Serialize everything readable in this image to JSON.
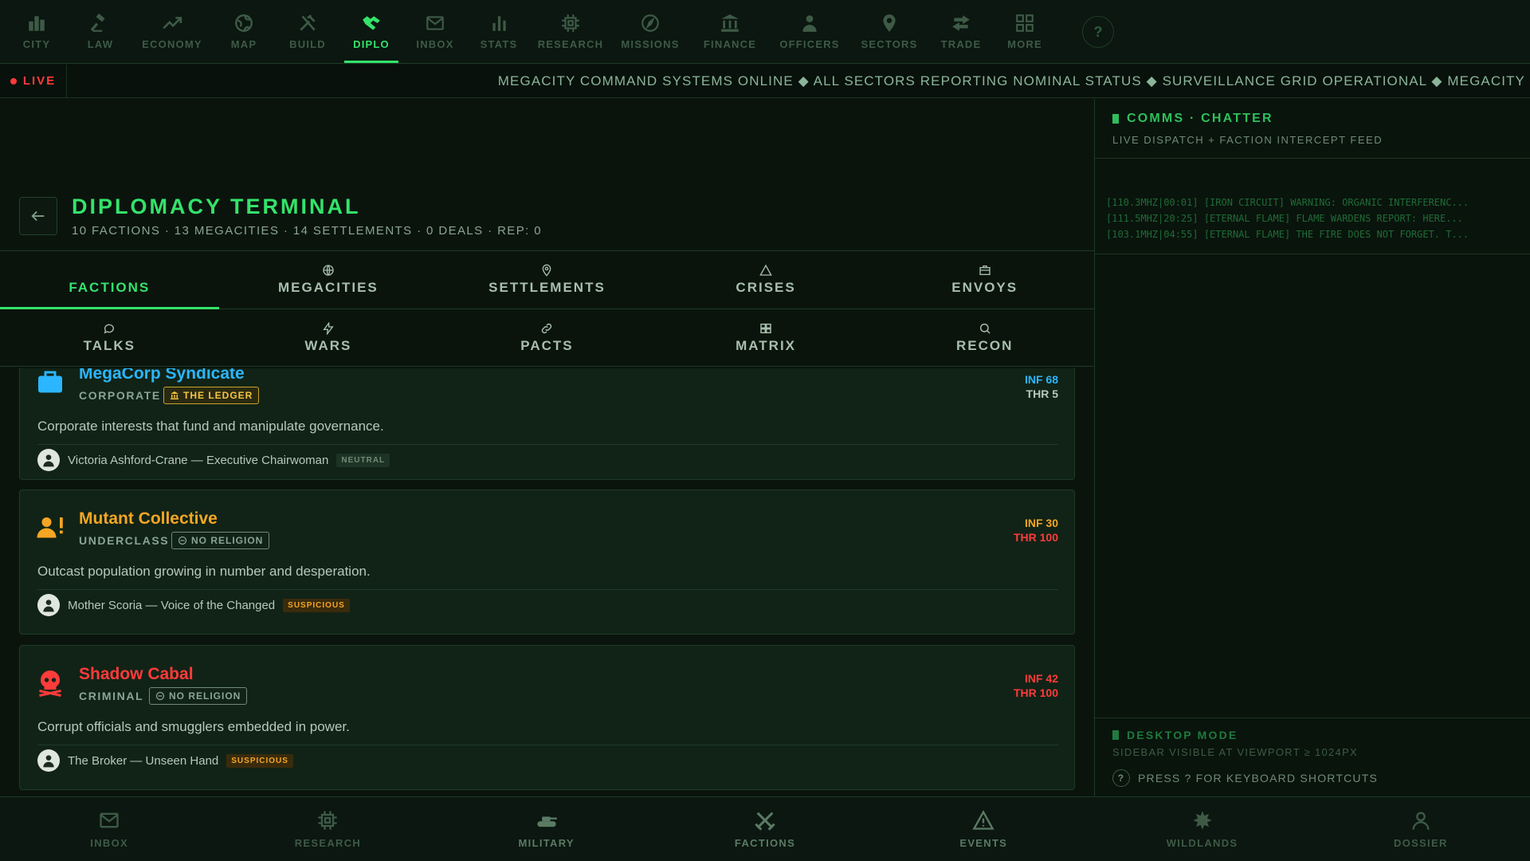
{
  "top_nav": {
    "items": [
      {
        "label": "CITY",
        "icon": "city-icon"
      },
      {
        "label": "LAW",
        "icon": "gavel-icon"
      },
      {
        "label": "ECONOMY",
        "icon": "trend-icon"
      },
      {
        "label": "MAP",
        "icon": "globe-icon"
      },
      {
        "label": "BUILD",
        "icon": "tools-icon"
      },
      {
        "label": "DIPLO",
        "icon": "handshake-icon",
        "active": true
      },
      {
        "label": "INBOX",
        "icon": "mail-icon"
      },
      {
        "label": "STATS",
        "icon": "bar-chart-icon"
      },
      {
        "label": "RESEARCH",
        "icon": "chip-icon"
      },
      {
        "label": "MISSIONS",
        "icon": "compass-icon"
      },
      {
        "label": "FINANCE",
        "icon": "bank-icon"
      },
      {
        "label": "OFFICERS",
        "icon": "officer-icon"
      },
      {
        "label": "SECTORS",
        "icon": "map-pin-icon"
      },
      {
        "label": "TRADE",
        "icon": "swap-icon"
      },
      {
        "label": "MORE",
        "icon": "grid-icon"
      }
    ],
    "help": "?"
  },
  "ticker": {
    "live_label": "LIVE",
    "text": "MEGACITY COMMAND SYSTEMS ONLINE ◆ ALL SECTORS REPORTING NOMINAL STATUS ◆ SURVEILLANCE GRID OPERATIONAL ◆ MEGACITY"
  },
  "header": {
    "title": "DIPLOMACY TERMINAL",
    "subtitle": "10 FACTIONS · 13 MEGACITIES · 14 SETTLEMENTS · 0 DEALS · REP: 0"
  },
  "tabs_row1": [
    {
      "label": "FACTIONS",
      "active": true
    },
    {
      "label": "MEGACITIES",
      "icon": "globe-icon"
    },
    {
      "label": "SETTLEMENTS",
      "icon": "map-pin-icon"
    },
    {
      "label": "CRISES",
      "icon": "warning-icon"
    },
    {
      "label": "ENVOYS",
      "icon": "briefcase-icon"
    }
  ],
  "tabs_row2": [
    {
      "label": "TALKS",
      "icon": "chat-icon"
    },
    {
      "label": "WARS",
      "icon": "lightning-icon"
    },
    {
      "label": "PACTS",
      "icon": "link-icon"
    },
    {
      "label": "MATRIX",
      "icon": "grid-icon"
    },
    {
      "label": "RECON",
      "icon": "search-icon"
    }
  ],
  "factions": [
    {
      "name": "MegaCorp Syndicate",
      "type": "CORPORATE",
      "badge": "THE LEDGER",
      "influence": "INF 68",
      "threat": "THR 5",
      "description": "Corporate interests that fund and manipulate governance.",
      "leader": "Victoria Ashford-Crane — Executive Chairwoman",
      "disposition": "NEUTRAL",
      "color": "#2bb6ff",
      "icon": "briefcase-icon"
    },
    {
      "name": "Mutant Collective",
      "type": "UNDERCLASS",
      "badge": "NO RELIGION",
      "influence": "INF 30",
      "threat": "THR 100",
      "description": "Outcast population growing in number and desperation.",
      "leader": "Mother Scoria — Voice of the Changed",
      "disposition": "SUSPICIOUS",
      "color": "#f5a623",
      "icon": "person-alert-icon"
    },
    {
      "name": "Shadow Cabal",
      "type": "CRIMINAL",
      "badge": "NO RELIGION",
      "influence": "INF 42",
      "threat": "THR 100",
      "description": "Corrupt officials and smugglers embedded in power.",
      "leader": "The Broker — Unseen Hand",
      "disposition": "SUSPICIOUS",
      "color": "#ff3b3b",
      "icon": "skull-icon"
    }
  ],
  "sidebar": {
    "title": "COMMS · CHATTER",
    "subtitle": "LIVE DISPATCH + FACTION INTERCEPT FEED",
    "feed": [
      "[110.3MHZ|00:01] [IRON CIRCUIT] WARNING: ORGANIC INTERFERENC...",
      "[111.5MHZ|20:25] [ETERNAL FLAME] FLAME WARDENS REPORT: HERE...",
      "[103.1MHZ|04:55] [ETERNAL FLAME] THE FIRE DOES NOT FORGET. T..."
    ],
    "footer_title": "DESKTOP MODE",
    "footer_sub": "SIDEBAR VISIBLE AT VIEWPORT ≥ 1024PX",
    "shortcut": "PRESS ? FOR KEYBOARD SHORTCUTS",
    "shortcut_key": "?"
  },
  "bottom_nav": [
    {
      "label": "INBOX",
      "icon": "mail-icon"
    },
    {
      "label": "RESEARCH",
      "icon": "chip-icon"
    },
    {
      "label": "MILITARY",
      "icon": "tank-icon"
    },
    {
      "label": "FACTIONS",
      "icon": "crossed-swords-icon"
    },
    {
      "label": "EVENTS",
      "icon": "warning-icon"
    },
    {
      "label": "WILDLANDS",
      "icon": "leaf-icon"
    },
    {
      "label": "DOSSIER",
      "icon": "user-icon"
    }
  ]
}
